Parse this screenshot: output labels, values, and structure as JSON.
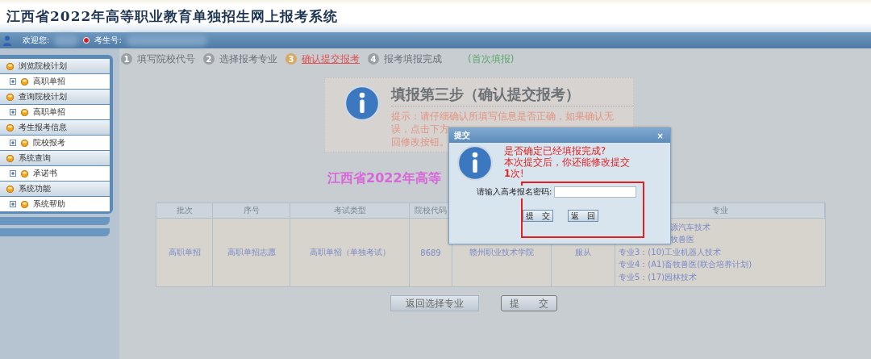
{
  "header": {
    "title": "江西省2022年高等职业教育单独招生网上报考系统"
  },
  "user_bar": {
    "welcome_label": "欢迎您:",
    "exam_number_label": "考生号:"
  },
  "sidebar": {
    "sections": [
      {
        "label": "浏览院校计划",
        "children": [
          {
            "label": "高职单招"
          }
        ]
      },
      {
        "label": "查询院校计划",
        "children": [
          {
            "label": "高职单招"
          }
        ]
      },
      {
        "label": "考生报考信息",
        "children": [
          {
            "label": "院校报考"
          }
        ]
      },
      {
        "label": "系统查询",
        "children": [
          {
            "label": "承诺书"
          }
        ]
      },
      {
        "label": "系统功能",
        "children": [
          {
            "label": "系统帮助"
          }
        ]
      }
    ]
  },
  "steps": [
    {
      "number": "1",
      "label": "填写院校代号",
      "selected": false
    },
    {
      "number": "2",
      "label": "选择报考专业",
      "selected": false
    },
    {
      "number": "3",
      "label": "确认提交报考",
      "selected": true
    },
    {
      "number": "4",
      "label": "报考填报完成",
      "selected": false
    }
  ],
  "fill_note": "(首次填报)",
  "info_box": {
    "title": "填报第三步（确认提交报考）",
    "hint_lines": [
      "提示：请仔细确认所填写信息是否正确，如果确认无",
      "误，点击下方",
      "回修改按钮。"
    ]
  },
  "page_heading": "江西省2022年高等",
  "table": {
    "columns": [
      "批次",
      "序号",
      "考试类型",
      "院校代码",
      "专业"
    ],
    "rows": [
      {
        "cells": [
          "高职单招",
          "高职单招志愿",
          "高职单招（单独考试）",
          "8689",
          "赣州职业技术学院",
          "服从"
        ],
        "majors": [
          {
            "text": "源汽车技术",
            "partial": true
          },
          {
            "text": "牧兽医",
            "partial": true
          },
          {
            "text": "专业3：(10)工业机器人技术",
            "partial": false
          },
          {
            "text": "专业4：(A1)畜牧兽医(联合培养计划)",
            "partial": false
          },
          {
            "text": "专业5：(17)园林技术",
            "partial": false
          }
        ]
      }
    ]
  },
  "actions": [
    "返回选择专业",
    "提　　交"
  ],
  "dialog": {
    "title": "提交",
    "close": "×",
    "message_lines": [
      "是否确定已经填报完成?",
      "本次提交后，你还能修改提交",
      "**1**次!"
    ],
    "password_label": "请输入高考报名密码:",
    "buttons": [
      "提　交",
      "返　回"
    ]
  }
}
